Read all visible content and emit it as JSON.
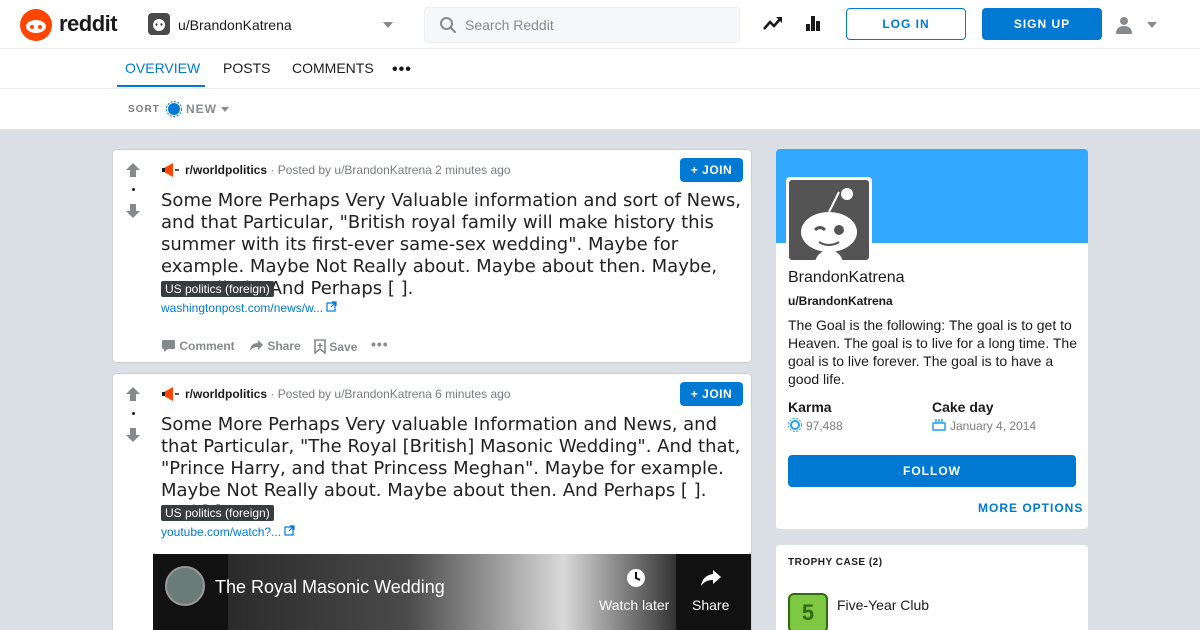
{
  "header": {
    "logo_text": "reddit",
    "user_dropdown": "u/BrandonKatrena",
    "search_placeholder": "Search Reddit",
    "login_label": "LOG IN",
    "signup_label": "SIGN UP",
    "brand_color": "#ff4500",
    "accent_color": "#0079d3"
  },
  "tabs": [
    {
      "label": "OVERVIEW",
      "active": true
    },
    {
      "label": "POSTS",
      "active": false
    },
    {
      "label": "COMMENTS",
      "active": false
    }
  ],
  "sort": {
    "label": "SORT",
    "value": "NEW"
  },
  "posts": [
    {
      "subreddit": "r/worldpolitics",
      "posted_by": "· Posted by u/BrandonKatrena 2 minutes ago",
      "join_label": "JOIN",
      "title": "Some More Perhaps Very Valuable information and sort of News, and that Particular, \"British royal family will make history this summer with its first-ever same-sex wedding\". Maybe for example. Maybe Not Really about. Maybe about then. Maybe, \"so-called\". And Perhaps [ ].",
      "flair": "US politics (foreign)",
      "link": "washingtonpost.com/news/w...",
      "actions": {
        "comment": "Comment",
        "share": "Share",
        "save": "Save"
      }
    },
    {
      "subreddit": "r/worldpolitics",
      "posted_by": "· Posted by u/BrandonKatrena 6 minutes ago",
      "join_label": "JOIN",
      "title": "Some More Perhaps Very valuable Information and News, and that Particular, \"The Royal [British] Masonic Wedding\". And that, \"Prince Harry, and that Princess Meghan\". Maybe for example. Maybe Not Really about. Maybe about then. And Perhaps [ ]. And [ ].",
      "flair": "US politics (foreign)",
      "link": "youtube.com/watch?...",
      "video": {
        "title": "The Royal Masonic Wedding",
        "watch_later": "Watch later",
        "share": "Share"
      }
    }
  ],
  "profile": {
    "display_name": "BrandonKatrena",
    "username": "u/BrandonKatrena",
    "bio": "The Goal is the following: The goal is to get to Heaven. The goal is to live for a long time. The goal is to live forever. The goal is to have a good life.",
    "karma_label": "Karma",
    "karma_value": "97,488",
    "cakeday_label": "Cake day",
    "cakeday_value": "January 4, 2014",
    "follow_label": "FOLLOW",
    "more_options_label": "MORE OPTIONS",
    "banner_color": "#33a8ff"
  },
  "trophy_case": {
    "title": "TROPHY CASE (2)",
    "items": [
      {
        "name": "Five-Year Club"
      }
    ]
  }
}
